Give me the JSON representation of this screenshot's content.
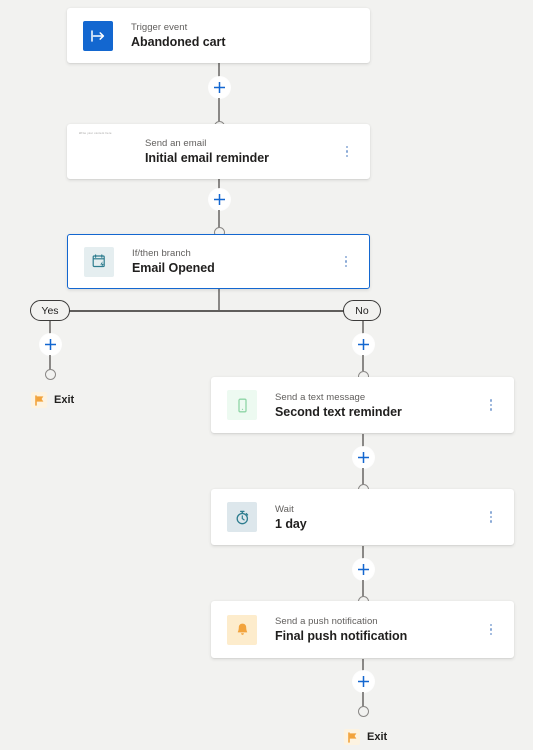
{
  "canvas": {
    "background": "#f2f2f0",
    "accent": "#1367d0"
  },
  "nodes": {
    "trigger": {
      "subtitle": "Trigger event",
      "title": "Abandoned cart",
      "icon": "trigger-arrow-icon",
      "icon_bg": "#1367d0",
      "icon_fg": "#ffffff"
    },
    "email": {
      "subtitle": "Send an email",
      "title": "Initial email reminder",
      "icon": "email-preview-thumbnail",
      "thumb_text": "Write your content here"
    },
    "branch": {
      "subtitle": "If/then branch",
      "title": "Email Opened",
      "icon": "branch-condition-icon",
      "icon_bg": "#e5eef0",
      "icon_fg": "#2e7d8f",
      "selected": true
    },
    "text_message": {
      "subtitle": "Send a text message",
      "title": "Second text reminder",
      "icon": "mobile-phone-icon",
      "icon_bg": "#edfaf1",
      "icon_fg": "#8fd5a6"
    },
    "wait": {
      "subtitle": "Wait",
      "title": "1 day",
      "icon": "stopwatch-icon",
      "icon_bg": "#dde7ec",
      "icon_fg": "#2e7d8f"
    },
    "push": {
      "subtitle": "Send a push notification",
      "title": "Final push notification",
      "icon": "bell-icon",
      "icon_bg": "#fdeccc",
      "icon_fg": "#f2a33c"
    }
  },
  "branch_labels": {
    "yes": "Yes",
    "no": "No"
  },
  "exits": {
    "yes_exit": "Exit",
    "no_exit": "Exit"
  },
  "add_buttons": {
    "after_trigger": "+",
    "after_email": "+",
    "yes_branch": "+",
    "no_branch": "+",
    "after_text": "+",
    "after_wait": "+",
    "after_push": "+"
  },
  "menus": {
    "email_menu": "More options",
    "branch_menu": "More options",
    "text_menu": "More options",
    "wait_menu": "More options",
    "push_menu": "More options"
  }
}
